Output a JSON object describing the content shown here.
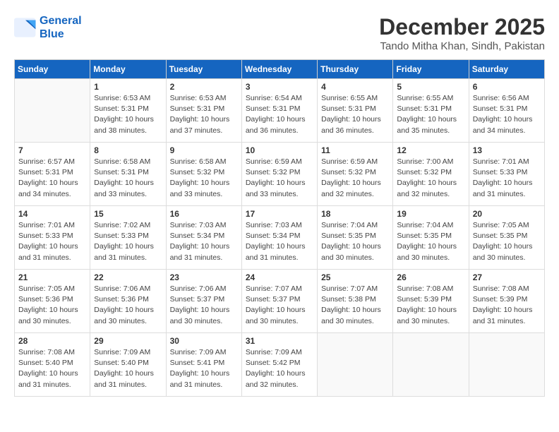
{
  "logo": {
    "line1": "General",
    "line2": "Blue"
  },
  "title": "December 2025",
  "location": "Tando Mitha Khan, Sindh, Pakistan",
  "weekdays": [
    "Sunday",
    "Monday",
    "Tuesday",
    "Wednesday",
    "Thursday",
    "Friday",
    "Saturday"
  ],
  "weeks": [
    [
      {
        "day": "",
        "info": ""
      },
      {
        "day": "1",
        "info": "Sunrise: 6:53 AM\nSunset: 5:31 PM\nDaylight: 10 hours\nand 38 minutes."
      },
      {
        "day": "2",
        "info": "Sunrise: 6:53 AM\nSunset: 5:31 PM\nDaylight: 10 hours\nand 37 minutes."
      },
      {
        "day": "3",
        "info": "Sunrise: 6:54 AM\nSunset: 5:31 PM\nDaylight: 10 hours\nand 36 minutes."
      },
      {
        "day": "4",
        "info": "Sunrise: 6:55 AM\nSunset: 5:31 PM\nDaylight: 10 hours\nand 36 minutes."
      },
      {
        "day": "5",
        "info": "Sunrise: 6:55 AM\nSunset: 5:31 PM\nDaylight: 10 hours\nand 35 minutes."
      },
      {
        "day": "6",
        "info": "Sunrise: 6:56 AM\nSunset: 5:31 PM\nDaylight: 10 hours\nand 34 minutes."
      }
    ],
    [
      {
        "day": "7",
        "info": "Sunrise: 6:57 AM\nSunset: 5:31 PM\nDaylight: 10 hours\nand 34 minutes."
      },
      {
        "day": "8",
        "info": "Sunrise: 6:58 AM\nSunset: 5:31 PM\nDaylight: 10 hours\nand 33 minutes."
      },
      {
        "day": "9",
        "info": "Sunrise: 6:58 AM\nSunset: 5:32 PM\nDaylight: 10 hours\nand 33 minutes."
      },
      {
        "day": "10",
        "info": "Sunrise: 6:59 AM\nSunset: 5:32 PM\nDaylight: 10 hours\nand 33 minutes."
      },
      {
        "day": "11",
        "info": "Sunrise: 6:59 AM\nSunset: 5:32 PM\nDaylight: 10 hours\nand 32 minutes."
      },
      {
        "day": "12",
        "info": "Sunrise: 7:00 AM\nSunset: 5:32 PM\nDaylight: 10 hours\nand 32 minutes."
      },
      {
        "day": "13",
        "info": "Sunrise: 7:01 AM\nSunset: 5:33 PM\nDaylight: 10 hours\nand 31 minutes."
      }
    ],
    [
      {
        "day": "14",
        "info": "Sunrise: 7:01 AM\nSunset: 5:33 PM\nDaylight: 10 hours\nand 31 minutes."
      },
      {
        "day": "15",
        "info": "Sunrise: 7:02 AM\nSunset: 5:33 PM\nDaylight: 10 hours\nand 31 minutes."
      },
      {
        "day": "16",
        "info": "Sunrise: 7:03 AM\nSunset: 5:34 PM\nDaylight: 10 hours\nand 31 minutes."
      },
      {
        "day": "17",
        "info": "Sunrise: 7:03 AM\nSunset: 5:34 PM\nDaylight: 10 hours\nand 31 minutes."
      },
      {
        "day": "18",
        "info": "Sunrise: 7:04 AM\nSunset: 5:35 PM\nDaylight: 10 hours\nand 30 minutes."
      },
      {
        "day": "19",
        "info": "Sunrise: 7:04 AM\nSunset: 5:35 PM\nDaylight: 10 hours\nand 30 minutes."
      },
      {
        "day": "20",
        "info": "Sunrise: 7:05 AM\nSunset: 5:35 PM\nDaylight: 10 hours\nand 30 minutes."
      }
    ],
    [
      {
        "day": "21",
        "info": "Sunrise: 7:05 AM\nSunset: 5:36 PM\nDaylight: 10 hours\nand 30 minutes."
      },
      {
        "day": "22",
        "info": "Sunrise: 7:06 AM\nSunset: 5:36 PM\nDaylight: 10 hours\nand 30 minutes."
      },
      {
        "day": "23",
        "info": "Sunrise: 7:06 AM\nSunset: 5:37 PM\nDaylight: 10 hours\nand 30 minutes."
      },
      {
        "day": "24",
        "info": "Sunrise: 7:07 AM\nSunset: 5:37 PM\nDaylight: 10 hours\nand 30 minutes."
      },
      {
        "day": "25",
        "info": "Sunrise: 7:07 AM\nSunset: 5:38 PM\nDaylight: 10 hours\nand 30 minutes."
      },
      {
        "day": "26",
        "info": "Sunrise: 7:08 AM\nSunset: 5:39 PM\nDaylight: 10 hours\nand 30 minutes."
      },
      {
        "day": "27",
        "info": "Sunrise: 7:08 AM\nSunset: 5:39 PM\nDaylight: 10 hours\nand 31 minutes."
      }
    ],
    [
      {
        "day": "28",
        "info": "Sunrise: 7:08 AM\nSunset: 5:40 PM\nDaylight: 10 hours\nand 31 minutes."
      },
      {
        "day": "29",
        "info": "Sunrise: 7:09 AM\nSunset: 5:40 PM\nDaylight: 10 hours\nand 31 minutes."
      },
      {
        "day": "30",
        "info": "Sunrise: 7:09 AM\nSunset: 5:41 PM\nDaylight: 10 hours\nand 31 minutes."
      },
      {
        "day": "31",
        "info": "Sunrise: 7:09 AM\nSunset: 5:42 PM\nDaylight: 10 hours\nand 32 minutes."
      },
      {
        "day": "",
        "info": ""
      },
      {
        "day": "",
        "info": ""
      },
      {
        "day": "",
        "info": ""
      }
    ]
  ]
}
